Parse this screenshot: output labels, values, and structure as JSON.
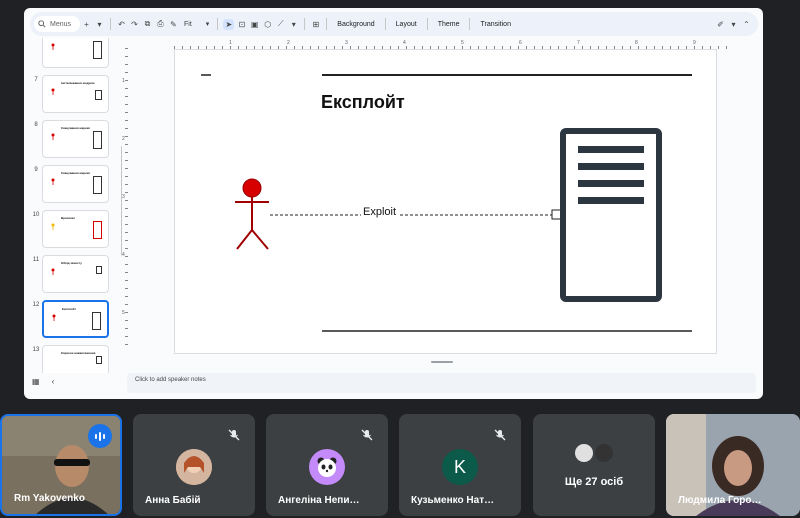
{
  "toolbar": {
    "menus_label": "Menus",
    "zoom": "Fit",
    "background": "Background",
    "layout": "Layout",
    "theme": "Theme",
    "transition": "Transition"
  },
  "filmstrip": {
    "slides": [
      {
        "num": "",
        "title": ""
      },
      {
        "num": "7",
        "title": "Інсталювання модулю"
      },
      {
        "num": "8",
        "title": "Сканування мережі"
      },
      {
        "num": "9",
        "title": "Сканування мережі"
      },
      {
        "num": "10",
        "title": "Вразливі"
      },
      {
        "num": "11",
        "title": "Обхід захисту"
      },
      {
        "num": "12",
        "title": "Експлойт"
      },
      {
        "num": "13",
        "title": "Корисне навантаження"
      }
    ]
  },
  "ruler": {
    "marks": [
      "1",
      "2",
      "3",
      "4",
      "5",
      "6",
      "7",
      "8",
      "9"
    ],
    "v_marks": [
      "1",
      "2",
      "3",
      "4",
      "5"
    ]
  },
  "slide": {
    "title": "Експлойт",
    "edge_label": "Exploit",
    "actor_color": "#d60000",
    "server_color": "#2b3640"
  },
  "notes": {
    "placeholder": "Click to add speaker notes"
  },
  "participants": [
    {
      "name": "Rm Yakovenko",
      "speaking": true
    },
    {
      "name": "Анна Бабій",
      "muted": true
    },
    {
      "name": "Ангеліна Непи…",
      "muted": true,
      "avatar_color": "#c58af9"
    },
    {
      "name": "Кузьменко Нат…",
      "muted": true,
      "initial": "K",
      "avatar_color": "#0b5a4a"
    },
    {
      "name": "Ще 27 осіб",
      "more": true
    },
    {
      "name": "Людмила Горо…"
    }
  ],
  "colors": {
    "accent": "#1a73e8",
    "tile": "#3c4043",
    "bg": "#202124"
  }
}
